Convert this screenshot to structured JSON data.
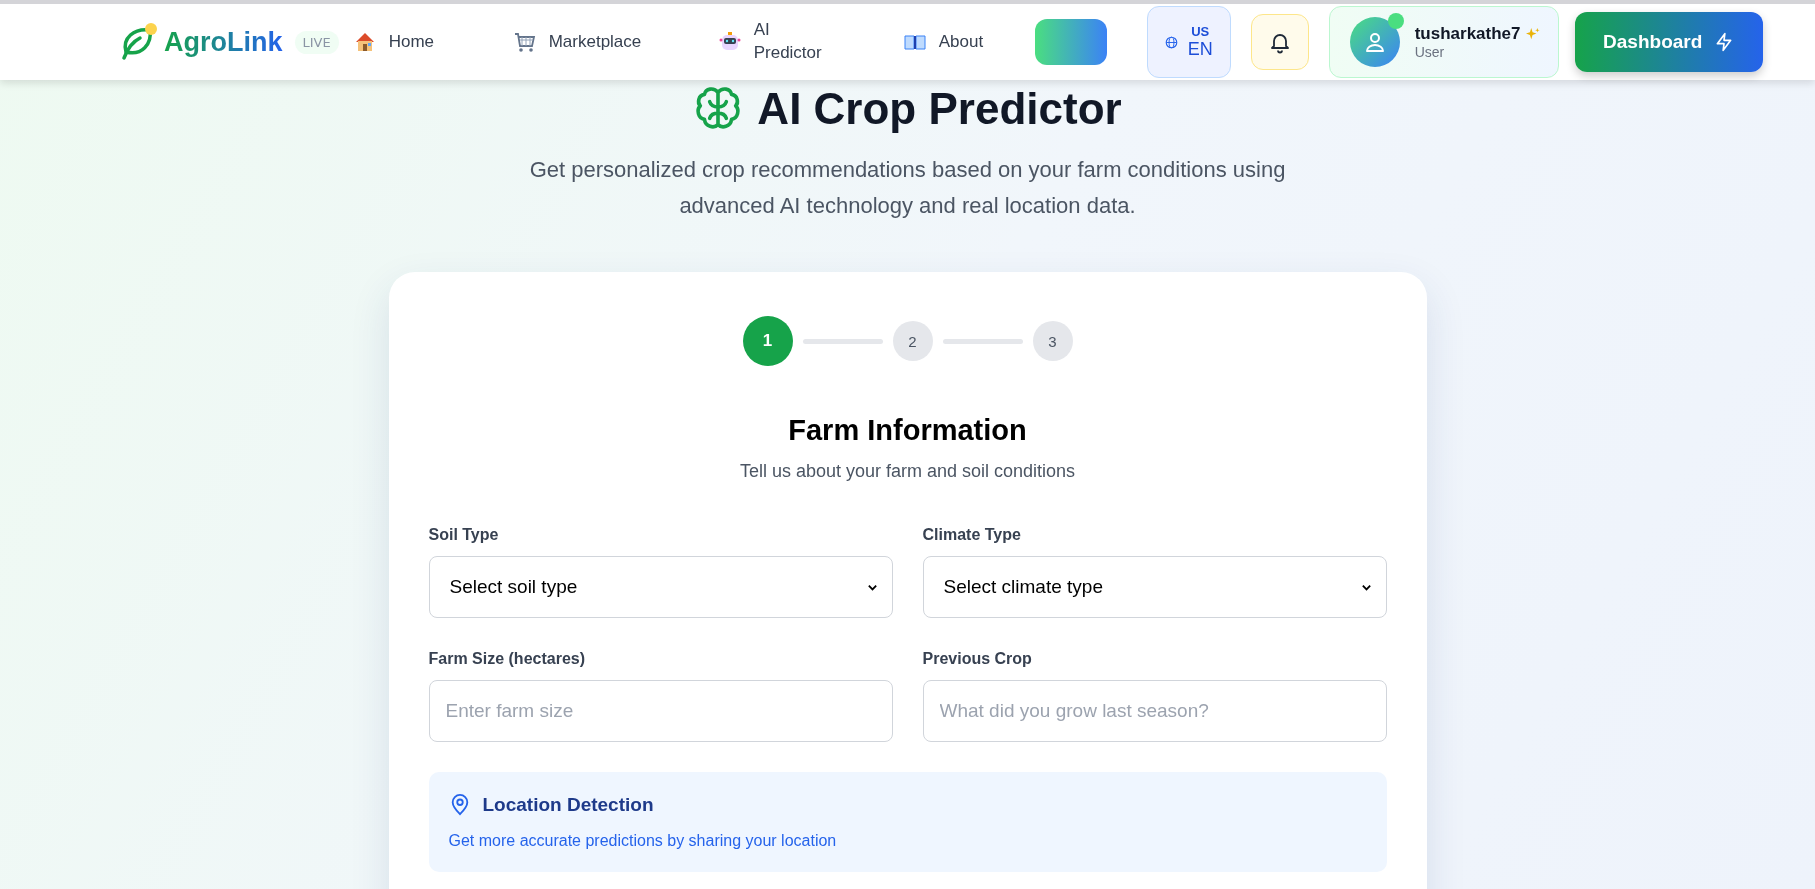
{
  "navbar": {
    "logo": "AgroLink",
    "live_badge": "LIVE",
    "links": [
      {
        "label": "Home",
        "kind": "house"
      },
      {
        "label": "Marketplace",
        "kind": "cart"
      },
      {
        "label": "AI Predictor",
        "kind": "robot"
      },
      {
        "label": "About",
        "kind": "book"
      }
    ],
    "language": {
      "region": "US",
      "code": "EN"
    },
    "user": {
      "name": "tusharkathe7",
      "role": "User",
      "online": true
    },
    "dashboard_button": "Dashboard"
  },
  "header": {
    "title": "AI Crop Predictor",
    "subtitle": "Get personalized crop recommendations based on your farm conditions using advanced AI technology and real location data."
  },
  "steps": [
    {
      "label": "1",
      "selected": true
    },
    {
      "label": "2",
      "selected": false
    },
    {
      "label": "3",
      "selected": false
    }
  ],
  "section": {
    "title": "Farm Information",
    "subtitle": "Tell us about your farm and soil conditions"
  },
  "fields": [
    {
      "label": "Soil Type",
      "kind": "select",
      "value": "Select soil type"
    },
    {
      "label": "Climate Type",
      "kind": "select",
      "value": "Select climate type"
    },
    {
      "label": "Farm Size (hectares)",
      "kind": "text",
      "placeholder": "Enter farm size"
    },
    {
      "label": "Previous Crop",
      "kind": "text",
      "placeholder": "What did you grow last season?"
    }
  ],
  "location": {
    "title": "Location Detection",
    "text": "Get more accurate predictions by sharing your location"
  }
}
